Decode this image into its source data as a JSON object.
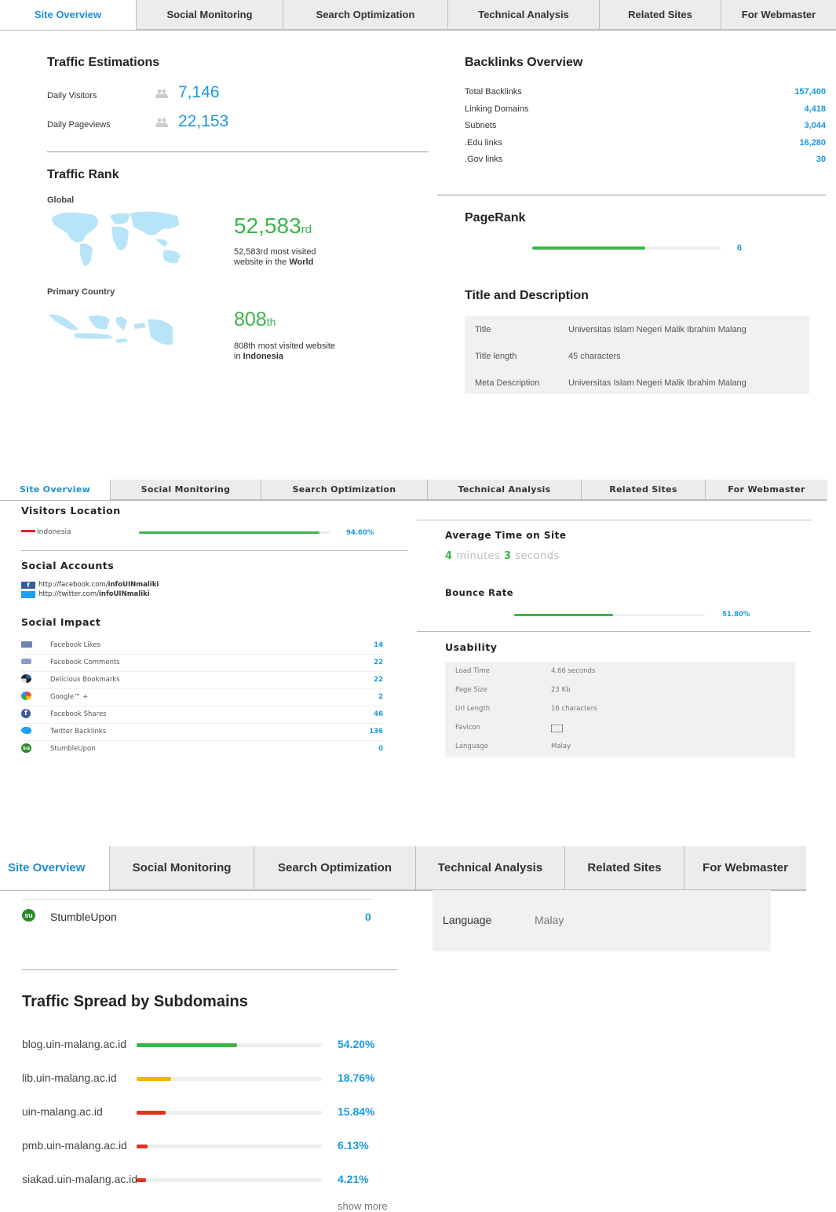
{
  "tabs": [
    "Site Overview",
    "Social Monitoring",
    "Search Optimization",
    "Technical Analysis",
    "Related Sites",
    "For Webmaster"
  ],
  "section1": {
    "traffic_estimations": {
      "heading": "Traffic Estimations",
      "daily_visitors_label": "Daily Visitors",
      "daily_visitors_value": "7,146",
      "daily_pageviews_label": "Daily Pageviews",
      "daily_pageviews_value": "22,153"
    },
    "traffic_rank": {
      "heading": "Traffic Rank",
      "global_label": "Global",
      "global_rank": "52,583",
      "global_suffix": "rd",
      "global_desc_1": "52,583rd most visited",
      "global_desc_2": "website in the",
      "global_desc_bold": "World",
      "country_label": "Primary Country",
      "country_rank": "808",
      "country_suffix": "th",
      "country_desc_1": "808th most visited website",
      "country_desc_2": "in",
      "country_desc_bold": "Indonesia"
    },
    "backlinks": {
      "heading": "Backlinks Overview",
      "rows": [
        {
          "label": "Total Backlinks",
          "value": "157,400"
        },
        {
          "label": "Linking Domains",
          "value": "4,418"
        },
        {
          "label": "Subnets",
          "value": "3,044"
        },
        {
          "label": ".Edu links",
          "value": "16,280"
        },
        {
          "label": ".Gov links",
          "value": "30"
        }
      ]
    },
    "pagerank": {
      "heading": "PageRank",
      "value": "6",
      "fraction": 0.6
    },
    "title_desc": {
      "heading": "Title and Description",
      "rows": [
        {
          "label": "Title",
          "value": "Universitas Islam Negeri Malik Ibrahim Malang"
        },
        {
          "label": "Title length",
          "value": "45 characters"
        },
        {
          "label": "Meta Description",
          "value": "Universitas Islam Negeri Malik Ibrahim Malang"
        }
      ]
    }
  },
  "section2": {
    "visitors_location": {
      "heading": "Visitors Location",
      "country": "Indonesia",
      "percent": "94.60%",
      "fraction": 0.946
    },
    "social_accounts": {
      "heading": "Social Accounts",
      "facebook_prefix": "http://facebook.com/",
      "facebook_bold": "infoUINmaliki",
      "twitter_prefix": "http://twitter.com/",
      "twitter_bold": "infoUINmaliki"
    },
    "social_impact": {
      "heading": "Social Impact",
      "rows": [
        {
          "label": "Facebook Likes",
          "value": "14",
          "icon": "thumbs-up-icon"
        },
        {
          "label": "Facebook Comments",
          "value": "22",
          "icon": "comment-icon"
        },
        {
          "label": "Delicious Bookmarks",
          "value": "22",
          "icon": "delicious-icon"
        },
        {
          "label": "Google™ +",
          "value": "2",
          "icon": "google-plus-icon"
        },
        {
          "label": "Facebook Shares",
          "value": "46",
          "icon": "facebook-icon"
        },
        {
          "label": "Twitter Backlinks",
          "value": "136",
          "icon": "twitter-icon"
        },
        {
          "label": "StumbleUpon",
          "value": "0",
          "icon": "stumbleupon-icon"
        }
      ]
    },
    "avg_time": {
      "heading": "Average Time on Site",
      "minutes": "4",
      "minutes_label": "minutes",
      "seconds": "3",
      "seconds_label": "seconds"
    },
    "bounce_rate": {
      "heading": "Bounce Rate",
      "percent": "51.80%",
      "fraction": 0.518
    },
    "usability": {
      "heading": "Usability",
      "rows": [
        {
          "label": "Load Time",
          "value": "4.66 seconds"
        },
        {
          "label": "Page Size",
          "value": "23 Kb"
        },
        {
          "label": "Url Length",
          "value": "16 characters"
        },
        {
          "label": "Favicon",
          "value": ""
        },
        {
          "label": "Language",
          "value": "Malay"
        }
      ]
    }
  },
  "section3": {
    "stumble_label": "StumbleUpon",
    "stumble_value": "0",
    "language_label": "Language",
    "language_value": "Malay",
    "subdomains": {
      "heading": "Traffic Spread by Subdomains",
      "rows": [
        {
          "domain": "blog.uin-malang.ac.id",
          "percent": "54.20%",
          "fraction": 0.542,
          "color": "#3bb54a"
        },
        {
          "domain": "lib.uin-malang.ac.id",
          "percent": "18.76%",
          "fraction": 0.1876,
          "color": "#f5b400"
        },
        {
          "domain": "uin-malang.ac.id",
          "percent": "15.84%",
          "fraction": 0.1584,
          "color": "#e2321e"
        },
        {
          "domain": "pmb.uin-malang.ac.id",
          "percent": "6.13%",
          "fraction": 0.0613,
          "color": "#e2321e"
        },
        {
          "domain": "siakad.uin-malang.ac.id",
          "percent": "4.21%",
          "fraction": 0.0421,
          "color": "#e2321e"
        }
      ],
      "show_more": "show more"
    }
  }
}
